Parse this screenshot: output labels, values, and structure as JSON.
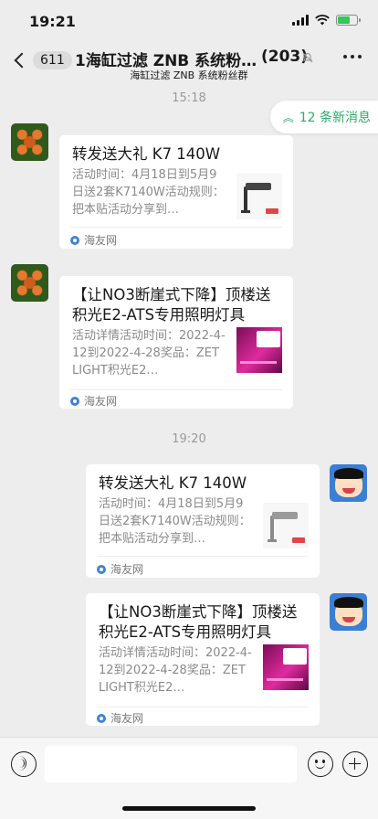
{
  "status_bar": {
    "time": "19:21",
    "battery_percent": 70
  },
  "nav": {
    "unread_count": "611",
    "title": "1海缸过滤 ZNB 系统粉…",
    "member_count": "(203)",
    "subtitle": "海缸过滤 ZNB 系统粉丝群"
  },
  "timestamps": [
    "15:18",
    "19:20"
  ],
  "new_messages": {
    "label": "12 条新消息"
  },
  "messages": [
    {
      "sender": "other",
      "title": "转发送大礼 K7 140W",
      "desc": "活动时间：4月18日到5月9日送2套K7140W活动规则：把本贴活动分享到…",
      "source": "海友网",
      "thumb": "lamp-icon"
    },
    {
      "sender": "other",
      "title": "【让NO3断崖式下降】顶楼送积光E2-ATS专用照明灯具",
      "desc": "活动详情活动时间：2022-4-12到2022-4-28奖品：ZETLIGHT积光E2…",
      "source": "海友网",
      "thumb": "grow-light-icon"
    },
    {
      "sender": "me",
      "title": "转发送大礼 K7 140W",
      "desc": "活动时间：4月18日到5月9日送2套K7140W活动规则：把本贴活动分享到…",
      "source": "海友网",
      "thumb": "lamp-icon"
    },
    {
      "sender": "me",
      "title": "【让NO3断崖式下降】顶楼送积光E2-ATS专用照明灯具",
      "desc": "活动详情活动时间：2022-4-12到2022-4-28奖品：ZETLIGHT积光E2…",
      "source": "海友网",
      "thumb": "grow-light-icon"
    }
  ],
  "input": {
    "placeholder": ""
  },
  "icons": [
    "back-icon",
    "mute-icon",
    "more-icon",
    "voice-icon",
    "emoji-icon",
    "plus-icon",
    "source-icon"
  ],
  "colors": {
    "accent_green": "#2aae67",
    "background": "#ededed",
    "card": "#ffffff"
  }
}
